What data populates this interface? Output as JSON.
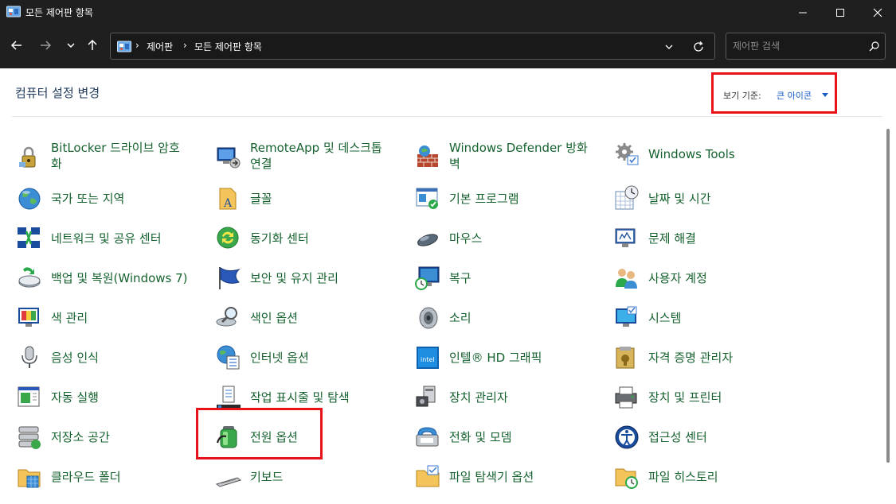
{
  "window": {
    "title": "모든 제어판 항목"
  },
  "address": {
    "crumbs": [
      "제어판",
      "모든 제어판 항목"
    ]
  },
  "search": {
    "placeholder": "제어판 검색"
  },
  "page": {
    "title": "컴퓨터 설정 변경"
  },
  "view_by": {
    "label": "보기 기준:",
    "value": "큰 아이콘"
  },
  "highlight_color": "#e8131a",
  "link_color": "#16622f",
  "items": [
    {
      "label": "BitLocker 드라이브 암호\n화",
      "icon": "bitlocker-icon"
    },
    {
      "label": "RemoteApp 및 데스크톱\n연결",
      "icon": "remoteapp-icon"
    },
    {
      "label": "Windows Defender 방화\n벽",
      "icon": "firewall-icon"
    },
    {
      "label": "Windows Tools",
      "icon": "windows-tools-icon"
    },
    {
      "label": "국가 또는 지역",
      "icon": "region-icon"
    },
    {
      "label": "글꼴",
      "icon": "fonts-icon"
    },
    {
      "label": "기본 프로그램",
      "icon": "default-programs-icon"
    },
    {
      "label": "날짜 및 시간",
      "icon": "date-time-icon"
    },
    {
      "label": "네트워크 및 공유 센터",
      "icon": "network-icon"
    },
    {
      "label": "동기화 센터",
      "icon": "sync-center-icon"
    },
    {
      "label": "마우스",
      "icon": "mouse-icon"
    },
    {
      "label": "문제 해결",
      "icon": "troubleshooting-icon"
    },
    {
      "label": "백업 및 복원(Windows 7)",
      "icon": "backup-icon"
    },
    {
      "label": "보안 및 유지 관리",
      "icon": "security-flag-icon"
    },
    {
      "label": "복구",
      "icon": "recovery-icon"
    },
    {
      "label": "사용자 계정",
      "icon": "user-accounts-icon"
    },
    {
      "label": "색 관리",
      "icon": "color-management-icon"
    },
    {
      "label": "색인 옵션",
      "icon": "indexing-icon"
    },
    {
      "label": "소리",
      "icon": "sound-icon"
    },
    {
      "label": "시스템",
      "icon": "system-icon"
    },
    {
      "label": "음성 인식",
      "icon": "microphone-icon"
    },
    {
      "label": "인터넷 옵션",
      "icon": "internet-options-icon"
    },
    {
      "label": "인텔® HD 그래픽",
      "icon": "intel-graphics-icon"
    },
    {
      "label": "자격 증명 관리자",
      "icon": "credential-manager-icon"
    },
    {
      "label": "자동 실행",
      "icon": "autoplay-icon"
    },
    {
      "label": "작업 표시줄 및 탐색",
      "icon": "taskbar-icon"
    },
    {
      "label": "장치 관리자",
      "icon": "device-manager-icon"
    },
    {
      "label": "장치 및 프린터",
      "icon": "printer-icon"
    },
    {
      "label": "저장소 공간",
      "icon": "storage-spaces-icon"
    },
    {
      "label": "전원 옵션",
      "icon": "power-options-icon"
    },
    {
      "label": "전화 및 모뎀",
      "icon": "phone-modem-icon"
    },
    {
      "label": "접근성 센터",
      "icon": "ease-of-access-icon"
    },
    {
      "label": "클라우드 폴더",
      "icon": "cloud-folder-icon"
    },
    {
      "label": "키보드",
      "icon": "keyboard-icon"
    },
    {
      "label": "파일 탐색기 옵션",
      "icon": "file-explorer-options-icon"
    },
    {
      "label": "파일 히스토리",
      "icon": "file-history-icon"
    }
  ]
}
